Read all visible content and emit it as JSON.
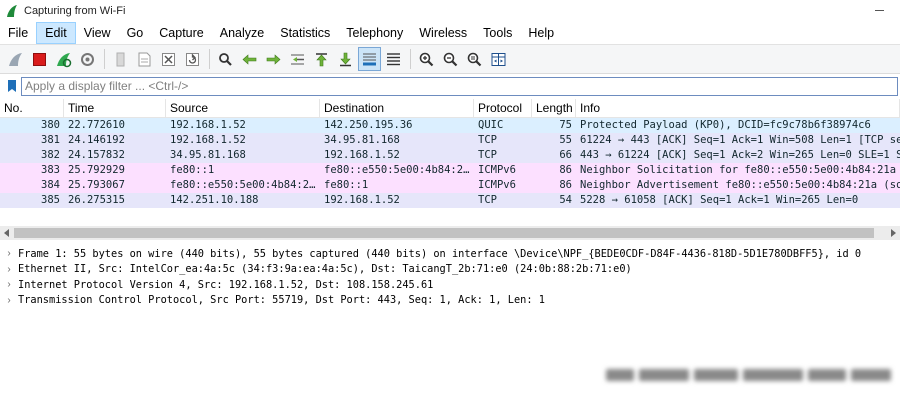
{
  "window": {
    "title": "Capturing from Wi-Fi"
  },
  "menu": [
    "File",
    "Edit",
    "View",
    "Go",
    "Capture",
    "Analyze",
    "Statistics",
    "Telephony",
    "Wireless",
    "Tools",
    "Help"
  ],
  "menu_active": "Edit",
  "toolbar": {
    "icons": [
      "shark-fin-start-icon",
      "stop-square-icon",
      "restart-fin-icon",
      "options-gear-icon",
      "open-folder-icon",
      "save-file-icon",
      "close-file-icon",
      "reload-icon",
      "find-magnifier-icon",
      "go-back-arrow-icon",
      "go-forward-arrow-icon",
      "go-to-packet-icon",
      "first-packet-icon",
      "last-packet-icon",
      "autoscroll-icon",
      "colorize-icon",
      "zoom-in-icon",
      "zoom-out-icon",
      "normal-size-icon",
      "resize-columns-icon"
    ]
  },
  "filter": {
    "placeholder": "Apply a display filter ... <Ctrl-/>",
    "value": ""
  },
  "packet_list": {
    "columns": [
      "No.",
      "Time",
      "Source",
      "Destination",
      "Protocol",
      "Length",
      "Info"
    ],
    "rows": [
      {
        "no": "380",
        "time": "22.772610",
        "source": "192.168.1.52",
        "destination": "142.250.195.36",
        "protocol": "QUIC",
        "length": "75",
        "info": "Protected Payload (KP0), DCID=fc9c78b6f38974c6",
        "bg": "#dbefff"
      },
      {
        "no": "381",
        "time": "24.146192",
        "source": "192.168.1.52",
        "destination": "34.95.81.168",
        "protocol": "TCP",
        "length": "55",
        "info": "61224 → 443 [ACK] Seq=1 Ack=1 Win=508 Len=1 [TCP segm",
        "bg": "#e6e6fa"
      },
      {
        "no": "382",
        "time": "24.157832",
        "source": "34.95.81.168",
        "destination": "192.168.1.52",
        "protocol": "TCP",
        "length": "66",
        "info": "443 → 61224 [ACK] Seq=1 Ack=2 Win=265 Len=0 SLE=1 SRE",
        "bg": "#e6e6fa"
      },
      {
        "no": "383",
        "time": "25.792929",
        "source": "fe80::1",
        "destination": "fe80::e550:5e00:4b84:2…",
        "protocol": "ICMPv6",
        "length": "86",
        "info": "Neighbor Solicitation for fe80::e550:5e00:4b84:21a fr",
        "bg": "#fce0ff"
      },
      {
        "no": "384",
        "time": "25.793067",
        "source": "fe80::e550:5e00:4b84:2…",
        "destination": "fe80::1",
        "protocol": "ICMPv6",
        "length": "86",
        "info": "Neighbor Advertisement fe80::e550:5e00:4b84:21a (sol,",
        "bg": "#fce0ff"
      },
      {
        "no": "385",
        "time": "26.275315",
        "source": "142.251.10.188",
        "destination": "192.168.1.52",
        "protocol": "TCP",
        "length": "54",
        "info": "5228 → 61058 [ACK] Seq=1 Ack=1 Win=265 Len=0",
        "bg": "#e6e6fa"
      }
    ]
  },
  "details": [
    "Frame 1: 55 bytes on wire (440 bits), 55 bytes captured (440 bits) on interface \\Device\\NPF_{BEDE0CDF-D84F-4436-818D-5D1E780DBFF5}, id 0",
    "Ethernet II, Src: IntelCor_ea:4a:5c (34:f3:9a:ea:4a:5c), Dst: TaicangT_2b:71:e0 (24:0b:88:2b:71:e0)",
    "Internet Protocol Version 4, Src: 192.168.1.52, Dst: 108.158.245.61",
    "Transmission Control Protocol, Src Port: 55719, Dst Port: 443, Seq: 1, Ack: 1, Len: 1"
  ],
  "colors": {
    "accent": "#1e6fb8",
    "quic_row": "#dbefff",
    "tcp_row": "#e6e6fa",
    "icmp_row": "#fce0ff"
  }
}
